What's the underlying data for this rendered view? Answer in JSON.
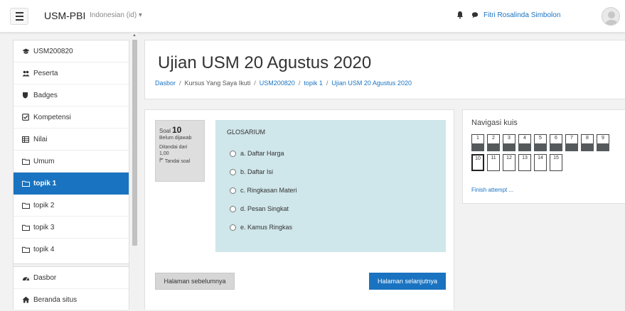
{
  "navbar": {
    "brand": "USM-PBI",
    "language": "Indonesian (id) ▾",
    "user_name": "Fitri Rosalinda Simbolon"
  },
  "sidebar": {
    "items": [
      {
        "label": "USM200820",
        "icon": "graduation-cap-icon"
      },
      {
        "label": "Peserta",
        "icon": "users-icon"
      },
      {
        "label": "Badges",
        "icon": "badge-shield-icon"
      },
      {
        "label": "Kompetensi",
        "icon": "checkbox-icon"
      },
      {
        "label": "Nilai",
        "icon": "table-grid-icon"
      },
      {
        "label": "Umum",
        "icon": "folder-icon"
      },
      {
        "label": "topik 1",
        "icon": "folder-icon",
        "active": true
      },
      {
        "label": "topik 2",
        "icon": "folder-icon"
      },
      {
        "label": "topik 3",
        "icon": "folder-icon"
      },
      {
        "label": "topik 4",
        "icon": "folder-icon"
      }
    ],
    "bottom_items": [
      {
        "label": "Dasbor",
        "icon": "dashboard-icon"
      },
      {
        "label": "Beranda situs",
        "icon": "home-icon"
      }
    ]
  },
  "header": {
    "title": "Ujian USM 20 Agustus 2020",
    "breadcrumb": [
      "Dasbor",
      "Kursus Yang Saya Ikuti",
      "USM200820",
      "topik 1",
      "Ujian USM 20 Agustus 2020"
    ]
  },
  "question": {
    "soal_label": "Soal",
    "number": "10",
    "status": "Belum dijawab",
    "mark_line1": "Ditandai dari",
    "mark_line2": "1,00",
    "flag_label": "Tandai soal",
    "text": "GLOSARIUM",
    "options": [
      "a. Daftar Harga",
      "b. Daftar Isi",
      "c. Ringkasan Materi",
      "d. Pesan Singkat",
      "e. Kamus Ringkas"
    ]
  },
  "buttons": {
    "prev": "Halaman sebelumnya",
    "next": "Halaman selanjutnya"
  },
  "quiz_nav": {
    "title": "Navigasi kuis",
    "row1": [
      "1",
      "2",
      "3",
      "4",
      "5",
      "6",
      "7",
      "8",
      "9"
    ],
    "row2": [
      "10",
      "11",
      "12",
      "13",
      "14",
      "15"
    ],
    "current": "10",
    "finish": "Finish attempt ..."
  },
  "colors": {
    "primary": "#1a73c0",
    "question_bg": "#cfe6ea",
    "answered_band": "#55595c"
  }
}
